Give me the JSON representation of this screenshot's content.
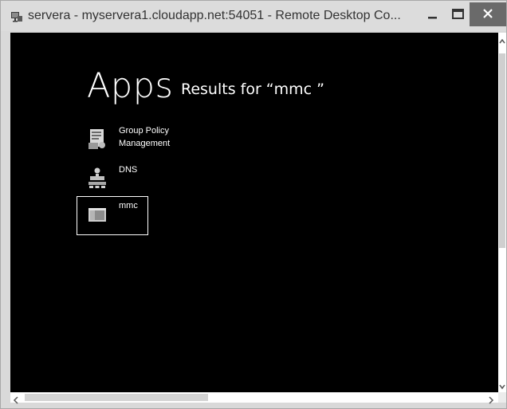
{
  "window": {
    "title": "servera - myservera1.cloudapp.net:54051 - Remote Desktop Co...",
    "icon": "remote-desktop-icon",
    "controls": [
      "minimize-icon",
      "maximize-icon",
      "close-icon"
    ]
  },
  "search": {
    "heading": "Apps",
    "results_label": "Results for “mmc ”"
  },
  "apps": [
    {
      "label_lines": [
        "Group Policy",
        "Management"
      ],
      "icon": "group-policy-icon",
      "selected": false
    },
    {
      "label_lines": [
        "DNS"
      ],
      "icon": "dns-icon",
      "selected": false
    },
    {
      "label_lines": [
        "mmc"
      ],
      "icon": "mmc-icon",
      "selected": true
    }
  ],
  "colors": {
    "desktop_background": "#000000",
    "titlebar": "#dcdcdc",
    "close_button": "#6a6a6a",
    "text": "#ffffff"
  }
}
